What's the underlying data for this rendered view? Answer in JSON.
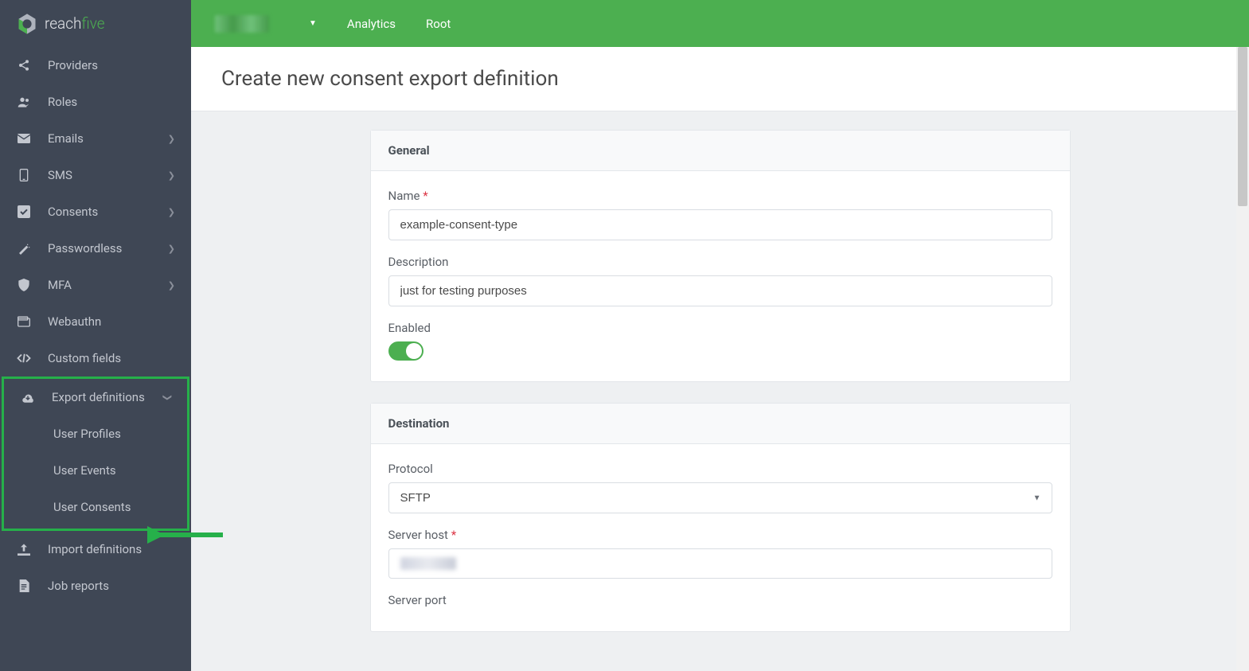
{
  "brand": {
    "name1": "reach",
    "name2": "five"
  },
  "topbar": {
    "analytics": "Analytics",
    "root": "Root"
  },
  "sidebar": {
    "providers": "Providers",
    "roles": "Roles",
    "emails": "Emails",
    "sms": "SMS",
    "consents": "Consents",
    "passwordless": "Passwordless",
    "mfa": "MFA",
    "webauthn": "Webauthn",
    "custom_fields": "Custom fields",
    "export_defs": "Export definitions",
    "user_profiles": "User Profiles",
    "user_events": "User Events",
    "user_consents": "User Consents",
    "import_defs": "Import definitions",
    "job_reports": "Job reports"
  },
  "page_title": "Create new consent export definition",
  "general": {
    "header": "General",
    "name_label": "Name",
    "name_value": "example-consent-type",
    "desc_label": "Description",
    "desc_value": "just for testing purposes",
    "enabled_label": "Enabled",
    "enabled_value": true
  },
  "destination": {
    "header": "Destination",
    "protocol_label": "Protocol",
    "protocol_value": "SFTP",
    "host_label": "Server host",
    "port_label": "Server port"
  }
}
